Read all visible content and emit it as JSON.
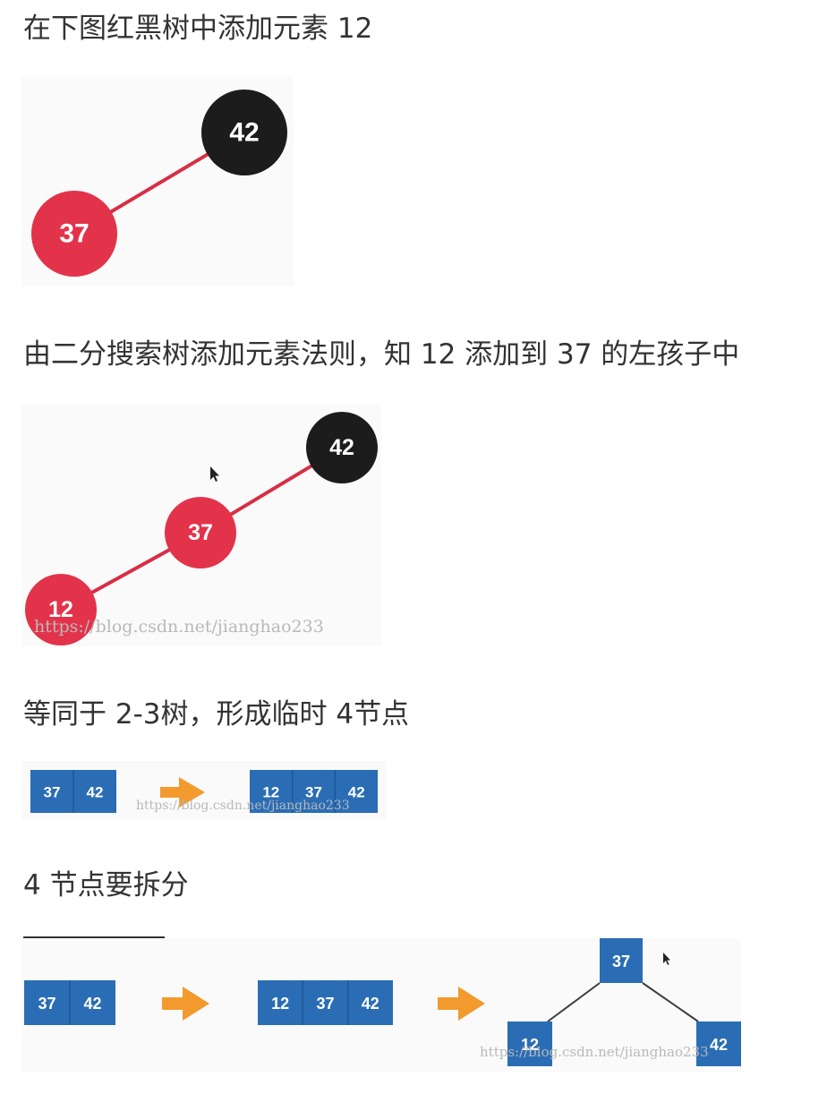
{
  "text": {
    "heading1": "在下图红黑树中添加元素 12",
    "heading2": "由二分搜索树添加元素法则，知 12 添加到 37 的左孩子中",
    "heading3": "等同于 2-3树，形成临时 4节点",
    "heading4": "4 节点要拆分"
  },
  "fig1": {
    "nodes": [
      "42",
      "37"
    ]
  },
  "fig2": {
    "nodes": [
      "42",
      "37",
      "12"
    ],
    "watermark": "https://blog.csdn.net/jianghao233"
  },
  "fig3": {
    "box_before": [
      "37",
      "42"
    ],
    "box_after": [
      "12",
      "37",
      "42"
    ],
    "watermark": "https://blog.csdn.net/jianghao233"
  },
  "fig4": {
    "box_before": [
      "37",
      "42"
    ],
    "box_middle": [
      "12",
      "37",
      "42"
    ],
    "tree": {
      "root": "37",
      "left": "12",
      "right": "42"
    },
    "watermark": "https://blog.csdn.net/jianghao233"
  },
  "colors": {
    "red_node": "#e2334a",
    "black_node": "#1c1c1c",
    "box_blue": "#2a6db5",
    "arrow_orange": "#f29a2e"
  }
}
